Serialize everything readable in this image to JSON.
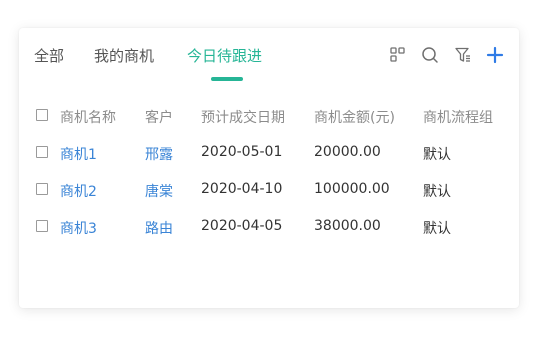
{
  "tabs": [
    {
      "label": "全部"
    },
    {
      "label": "我的商机"
    },
    {
      "label": "今日待跟进"
    }
  ],
  "active_tab": "今日待跟进",
  "colors": {
    "accent": "#26b596",
    "link": "#3a84d6",
    "add": "#2f7be6"
  },
  "icons": [
    "layout-grid-icon",
    "search-icon",
    "filter-settings-icon",
    "plus-icon"
  ],
  "table": {
    "headers": [
      "商机名称",
      "客户",
      "预计成交日期",
      "商机金额(元)",
      "商机流程组"
    ],
    "rows": [
      {
        "name": "商机1",
        "customer": "邢露",
        "date": "2020-05-01",
        "amount": "20000.00",
        "flow": "默认"
      },
      {
        "name": "商机2",
        "customer": "唐棠",
        "date": "2020-04-10",
        "amount": "100000.00",
        "flow": "默认"
      },
      {
        "name": "商机3",
        "customer": "路由",
        "date": "2020-04-05",
        "amount": "38000.00",
        "flow": "默认"
      }
    ]
  }
}
